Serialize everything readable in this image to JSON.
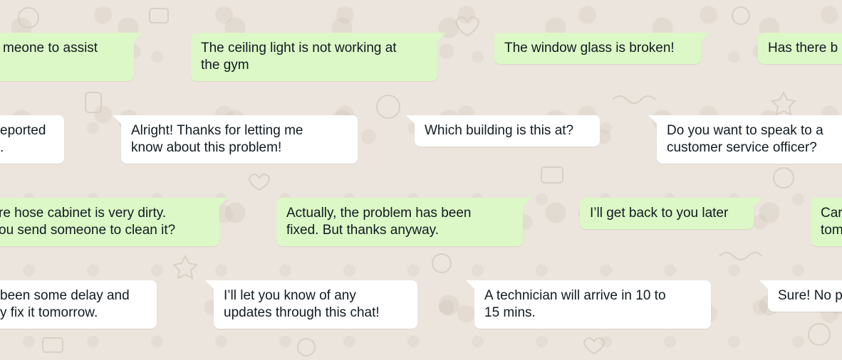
{
  "theme": {
    "background": "#ece5dd",
    "outgoing_bubble": "#dcf8c6",
    "incoming_bubble": "#ffffff",
    "text_color": "#111b21"
  },
  "messages": {
    "m1": {
      "direction": "outgoing",
      "lines": [
        "meone to assist"
      ]
    },
    "m2": {
      "direction": "outgoing",
      "lines": [
        "The ceiling light is not working at",
        "the gym"
      ]
    },
    "m3": {
      "direction": "outgoing",
      "lines": [
        "The window glass is broken!"
      ]
    },
    "m4": {
      "direction": "outgoing",
      "lines": [
        "Has there b"
      ]
    },
    "m5": {
      "direction": "incoming",
      "lines": [
        "eported",
        "."
      ]
    },
    "m6": {
      "direction": "incoming",
      "lines": [
        "Alright! Thanks for letting me",
        "know about this problem!"
      ]
    },
    "m7": {
      "direction": "incoming",
      "lines": [
        "Which building is this at?"
      ]
    },
    "m8": {
      "direction": "incoming",
      "lines": [
        "Do you want to speak to a",
        "customer service officer?"
      ]
    },
    "m9": {
      "direction": "outgoing",
      "lines": [
        "re hose cabinet is very dirty.",
        "ou send someone to clean it?"
      ]
    },
    "m10": {
      "direction": "outgoing",
      "lines": [
        "Actually, the problem has been",
        "fixed. But thanks anyway."
      ]
    },
    "m11": {
      "direction": "outgoing",
      "lines": [
        "I’ll get back to you later"
      ]
    },
    "m12": {
      "direction": "outgoing",
      "lines": [
        "Car",
        "tom"
      ]
    },
    "m13": {
      "direction": "incoming",
      "lines": [
        "been some delay and",
        "y fix it tomorrow."
      ]
    },
    "m14": {
      "direction": "incoming",
      "lines": [
        "I’ll let you know of any",
        "updates through this chat!"
      ]
    },
    "m15": {
      "direction": "incoming",
      "lines": [
        "A technician will arrive in 10 to",
        "15 mins."
      ]
    },
    "m16": {
      "direction": "incoming",
      "lines": [
        "Sure! No p"
      ]
    }
  }
}
